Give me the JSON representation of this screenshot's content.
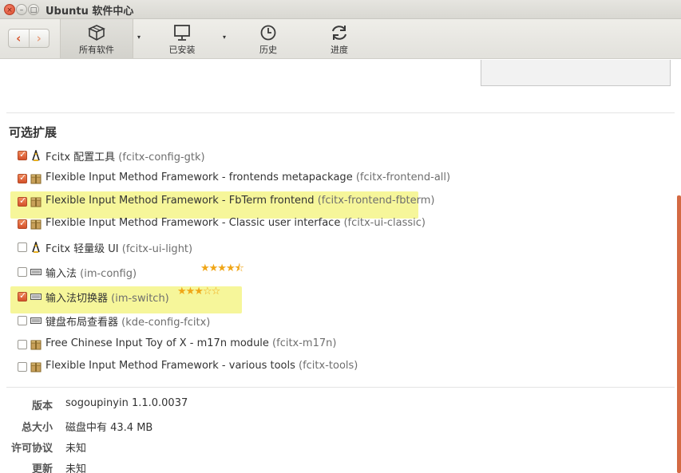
{
  "window": {
    "title": "Ubuntu 软件中心",
    "close_glyph": "×",
    "min_glyph": "–",
    "max_glyph": "□"
  },
  "toolbar": {
    "back_glyph": "‹",
    "forward_glyph": "›",
    "tabs": [
      {
        "label": "所有软件",
        "icon": "box-icon"
      },
      {
        "label": "已安装",
        "icon": "monitor-icon"
      },
      {
        "label": "历史",
        "icon": "clock-icon"
      },
      {
        "label": "进度",
        "icon": "refresh-icon"
      }
    ],
    "dropdown_glyph": "▾"
  },
  "addons": {
    "title": "可选扩展",
    "items": [
      {
        "name": "Fcitx 配置工具",
        "pkg": "(fcitx-config-gtk)",
        "checked": true,
        "icon": "penguin-icon",
        "highlighted": false
      },
      {
        "name": "Flexible Input Method Framework - frontends metapackage",
        "pkg": "(fcitx-frontend-all)",
        "checked": true,
        "icon": "package-icon",
        "highlighted": false
      },
      {
        "name": "Flexible Input Method Framework - FbTerm frontend",
        "pkg": "(fcitx-frontend-fbterm)",
        "checked": true,
        "icon": "package-icon",
        "highlighted": true
      },
      {
        "name": "Flexible Input Method Framework - Classic user interface",
        "pkg": "(fcitx-ui-classic)",
        "checked": true,
        "icon": "package-icon",
        "highlighted": false
      },
      {
        "name": "Fcitx 轻量级 UI",
        "pkg": "(fcitx-ui-light)",
        "checked": false,
        "icon": "penguin-icon",
        "highlighted": false
      },
      {
        "name": "输入法",
        "pkg": "(im-config)",
        "checked": false,
        "icon": "keyboard-icon",
        "highlighted": false,
        "stars": "★★★★⯪"
      },
      {
        "name": "输入法切换器",
        "pkg": "(im-switch)",
        "checked": true,
        "icon": "keyboard-icon",
        "highlighted": true,
        "stars": "★★★☆☆"
      },
      {
        "name": "键盘布局查看器",
        "pkg": "(kde-config-fcitx)",
        "checked": false,
        "icon": "keyboard-icon",
        "highlighted": false
      },
      {
        "name": "Free Chinese Input Toy of X - m17n module",
        "pkg": "(fcitx-m17n)",
        "checked": false,
        "icon": "package-icon",
        "highlighted": false
      },
      {
        "name": "Flexible Input Method Framework - various tools",
        "pkg": "(fcitx-tools)",
        "checked": false,
        "icon": "package-icon",
        "highlighted": false
      }
    ]
  },
  "details": [
    {
      "label": "版本",
      "value": "sogoupinyin 1.1.0.0037"
    },
    {
      "label": "总大小",
      "value": "磁盘中有 43.4 MB"
    },
    {
      "label": "许可协议",
      "value": "未知"
    },
    {
      "label": "更新",
      "value": "未知"
    }
  ],
  "colors": {
    "accent": "#dd4814",
    "highlight": "#f6f69a",
    "star": "#f0a617"
  }
}
